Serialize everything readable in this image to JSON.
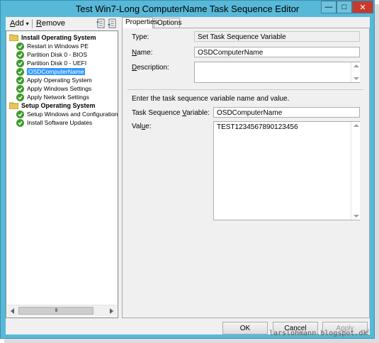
{
  "window": {
    "title": "Test Win7-Long ComputerName Task Sequence Editor",
    "close_glyph": "✕",
    "minimize_glyph": "—",
    "maximize_glyph": "□",
    "frame_color": "#58b8d8",
    "close_color": "#c7392c"
  },
  "toolbar": {
    "add_label_a": "A",
    "add_label_rest": "dd",
    "add_arrow": "▾",
    "remove_label_a": "R",
    "remove_label_rest": "emove",
    "icons": [
      "move-up-icon",
      "move-down-icon"
    ]
  },
  "tree": {
    "groups": [
      {
        "label": "Install Operating System",
        "icon": "folder-icon",
        "items": [
          {
            "label": "Restart in Windows PE",
            "selected": false
          },
          {
            "label": "Partition Disk 0 - BIOS",
            "selected": false
          },
          {
            "label": "Partition Disk 0 - UEFI",
            "selected": false
          },
          {
            "label": "OSDComputerName",
            "selected": true
          },
          {
            "label": "Apply Operating System",
            "selected": false
          },
          {
            "label": "Apply Windows Settings",
            "selected": false
          },
          {
            "label": "Apply Network Settings",
            "selected": false
          }
        ]
      },
      {
        "label": "Setup Operating System",
        "icon": "folder-icon",
        "items": [
          {
            "label": "Setup Windows and Configuration",
            "selected": false
          },
          {
            "label": "Install Software Updates",
            "selected": false
          }
        ]
      }
    ],
    "scroll_thumb": "III"
  },
  "tabs": [
    {
      "label": "Properties",
      "active": true
    },
    {
      "label": "Options",
      "active": false
    }
  ],
  "properties": {
    "type_label": "Type:",
    "type_value": "Set Task Sequence Variable",
    "name_label_a": "N",
    "name_label_rest": "ame:",
    "name_value": "OSDComputerName",
    "description_label_a": "D",
    "description_label_rest": "escription:",
    "description_value": "",
    "instruction": "Enter the task sequence variable name and value.",
    "variable_label_pre": "Task Sequence ",
    "variable_label_u": "V",
    "variable_label_post": "ariable:",
    "variable_value": "OSDComputerName",
    "value_label_pre": "Val",
    "value_label_u": "u",
    "value_label_post": "e:",
    "value_value": "TEST1234567890123456"
  },
  "buttons": {
    "ok": "OK",
    "cancel_pre": "Cancel",
    "apply_pre": "A",
    "apply_u": "p",
    "apply_post": "ply"
  },
  "watermark": "larslohmann.blogspot.dk",
  "colors": {
    "selection": "#3399ff",
    "success_check": "#3c9a2c"
  }
}
